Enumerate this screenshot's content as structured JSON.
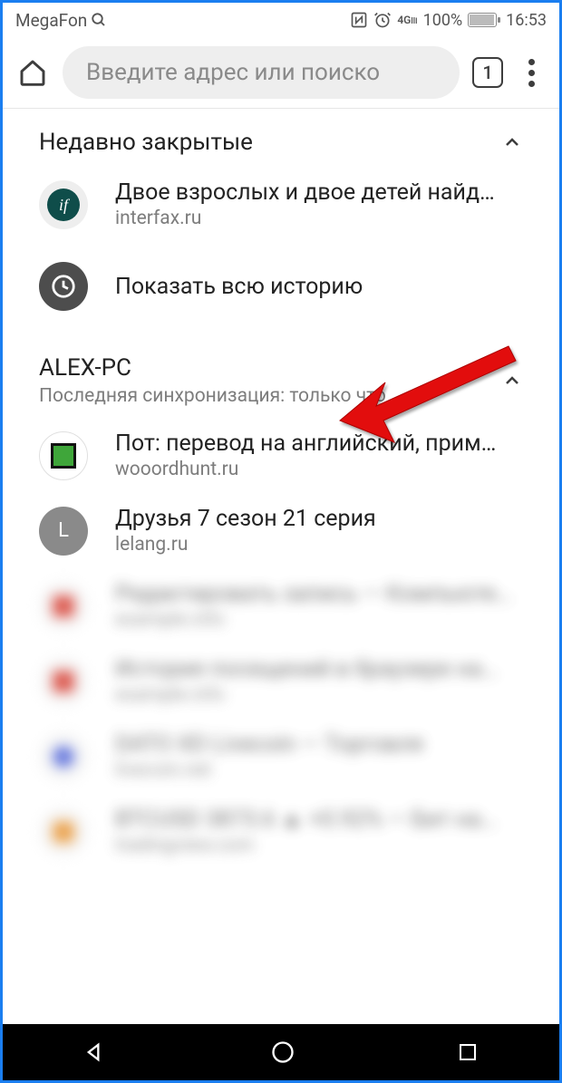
{
  "status": {
    "carrier": "MegaFon",
    "network": "4G",
    "battery_pct": "100%",
    "time": "16:53"
  },
  "toolbar": {
    "address_placeholder": "Введите адрес или поиско",
    "tab_count": "1"
  },
  "sections": {
    "recent": {
      "title": "Недавно закрытые",
      "items": [
        {
          "title": "Двое взрослых и двое детей найд…",
          "domain": "interfax.ru"
        }
      ],
      "show_all": "Показать всю историю"
    },
    "sync": {
      "title": "ALEX-PC",
      "subtitle": "Последняя синхронизация: только что",
      "items": [
        {
          "title": "Пот: перевод на английский, прим…",
          "domain": "wooordhunt.ru"
        },
        {
          "title": "Друзья 7 сезон 21 серия",
          "domain": "lelang.ru"
        }
      ]
    }
  }
}
